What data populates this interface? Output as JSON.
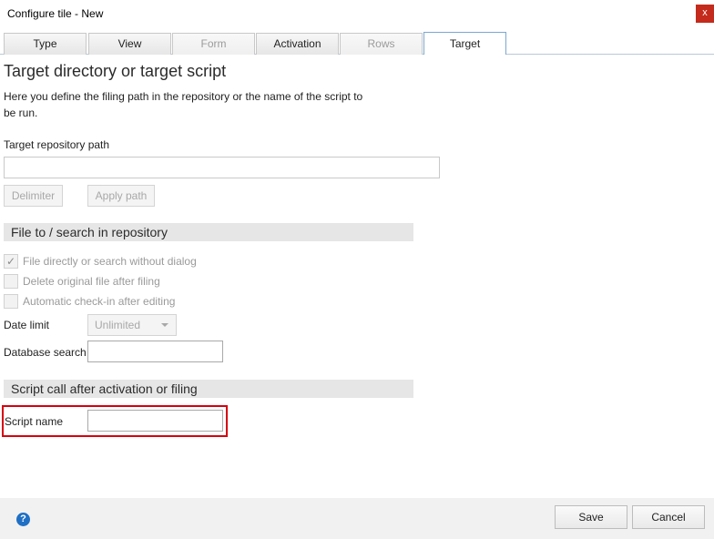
{
  "window": {
    "title": "Configure tile - New",
    "close_label": "x"
  },
  "tabs": [
    {
      "label": "Type",
      "state": "normal"
    },
    {
      "label": "View",
      "state": "normal"
    },
    {
      "label": "Form",
      "state": "disabled"
    },
    {
      "label": "Activation",
      "state": "normal"
    },
    {
      "label": "Rows",
      "state": "disabled"
    },
    {
      "label": "Target",
      "state": "active"
    }
  ],
  "main": {
    "heading": "Target directory or target script",
    "description": "Here you define the filing path in the repository or the name of the script to be run.",
    "repo_path_label": "Target repository path",
    "repo_path_value": "",
    "delimiter_button": "Delimiter",
    "apply_path_button": "Apply path"
  },
  "file_section": {
    "title": "File to / search in repository",
    "checkboxes": [
      {
        "label": "File directly or search without dialog",
        "checked": true
      },
      {
        "label": "Delete original file after filing",
        "checked": false
      },
      {
        "label": "Automatic check-in after editing",
        "checked": false
      }
    ],
    "date_limit_label": "Date limit",
    "date_limit_value": "Unlimited",
    "database_search_label": "Database search",
    "database_search_value": ""
  },
  "script_section": {
    "title": "Script call after activation or filing",
    "script_name_label": "Script name",
    "script_name_value": ""
  },
  "footer": {
    "help_icon": "?",
    "save_label": "Save",
    "cancel_label": "Cancel"
  },
  "colors": {
    "highlight": "#d6000f",
    "section_bg": "#e6e6e6",
    "help_icon": "#1f6fc5",
    "close_button": "#c42b1c"
  }
}
